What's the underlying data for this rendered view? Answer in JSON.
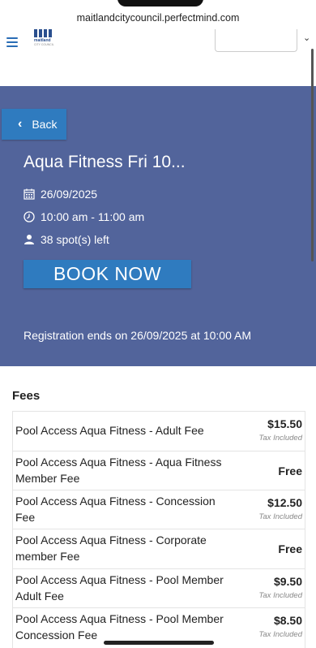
{
  "browser": {
    "url": "maitlandcitycouncil.perfectmind.com"
  },
  "nav": {
    "logo_name": "maitland",
    "logo_sub": "CITY COUNCIL"
  },
  "hero": {
    "back_label": "Back",
    "title": "Aqua Fitness Fri 10...",
    "date": "26/09/2025",
    "time": "10:00 am - 11:00 am",
    "spots": "38 spot(s) left",
    "book_label": "BOOK NOW",
    "registration_ends": "Registration ends on 26/09/2025 at 10:00 AM"
  },
  "fees": {
    "title": "Fees",
    "items": [
      {
        "name": "Pool Access Aqua Fitness - Adult Fee",
        "price": "$15.50",
        "tax": "Tax Included"
      },
      {
        "name": "Pool Access Aqua Fitness - Aqua Fitness Member Fee",
        "price": "Free",
        "tax": ""
      },
      {
        "name": "Pool Access Aqua Fitness - Concession Fee",
        "price": "$12.50",
        "tax": "Tax Included"
      },
      {
        "name": "Pool Access Aqua Fitness - Corporate member Fee",
        "price": "Free",
        "tax": ""
      },
      {
        "name": "Pool Access Aqua Fitness - Pool Member Adult Fee",
        "price": "$9.50",
        "tax": "Tax Included"
      },
      {
        "name": "Pool Access Aqua Fitness - Pool Member Concession Fee",
        "price": "$8.50",
        "tax": "Tax Included"
      }
    ]
  },
  "colors": {
    "hero_bg": "#52649b",
    "button_blue": "#2f7bbf"
  }
}
